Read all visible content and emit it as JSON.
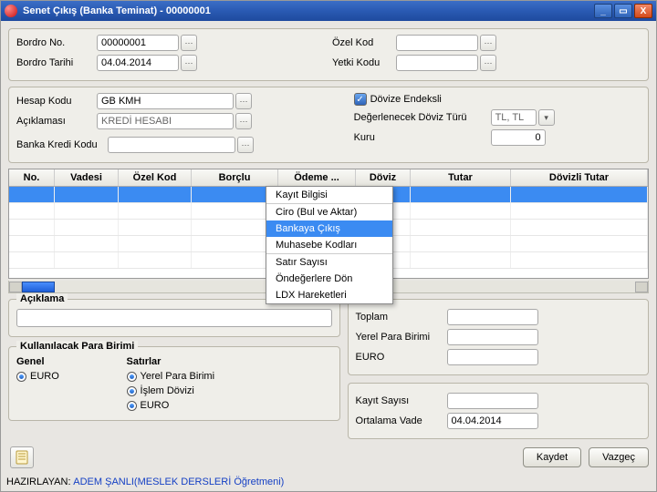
{
  "title": "Senet Çıkış (Banka Teminat) - 00000001",
  "top": {
    "bordroNoLabel": "Bordro No.",
    "bordroNo": "00000001",
    "bordroTarihLabel": "Bordro Tarihi",
    "bordroTarih": "04.04.2014",
    "ozelKodLabel": "Özel Kod",
    "ozelKod": "",
    "yetkiKoduLabel": "Yetki Kodu",
    "yetkiKodu": ""
  },
  "hesap": {
    "hesapKoduLabel": "Hesap Kodu",
    "hesapKodu": "GB   KMH",
    "aciklamaLabel": "Açıklaması",
    "aciklama": "KREDİ HESABI",
    "bankaKrediKoduLabel": "Banka Kredi Kodu",
    "bankaKrediKodu": ""
  },
  "doviz": {
    "endeksliLabel": "Dövize Endeksli",
    "turLabel": "Değerlenecek Döviz Türü",
    "tur": "TL, TL",
    "kuruLabel": "Kuru",
    "kuru": "0"
  },
  "gridHeaders": {
    "no": "No.",
    "vadesi": "Vadesi",
    "ozelKod": "Özel Kod",
    "borclu": "Borçlu",
    "odeme": "Ödeme ...",
    "doviz": "Döviz",
    "tutar": "Tutar",
    "dovizliTutar": "Dövizli Tutar"
  },
  "context": {
    "kayitBilgisi": "Kayıt Bilgisi",
    "ciro": "Ciro (Bul ve Aktar)",
    "bankayaCikis": "Bankaya Çıkış",
    "muhasebe": "Muhasebe Kodları",
    "satirSayisi": "Satır Sayısı",
    "ondeger": "Öndeğerlere Dön",
    "ldx": "LDX Hareketleri"
  },
  "aciklamaBox": {
    "label": "Açıklama",
    "value": ""
  },
  "totals": {
    "toplamLabel": "Toplam",
    "toplam": "",
    "yerelParaLabel": "Yerel Para Birimi",
    "yerelPara": "",
    "euroLabel": "EURO",
    "euro": "",
    "kayitSayisiLabel": "Kayıt Sayısı",
    "kayitSayisi": "",
    "ortVadeLabel": "Ortalama Vade",
    "ortVade": "04.04.2014"
  },
  "currency": {
    "groupLabel": "Kullanılacak Para Birimi",
    "genelLabel": "Genel",
    "satirlarLabel": "Satırlar",
    "euro": "EURO",
    "yerelPara": "Yerel Para Birimi",
    "islemDoviz": "İşlem Dövizi"
  },
  "buttons": {
    "kaydet": "Kaydet",
    "vazgec": "Vazgeç"
  },
  "footer": {
    "label": "HAZIRLAYAN:",
    "rest": "ADEM ŞANLI(MESLEK DERSLERİ Öğretmeni)"
  }
}
